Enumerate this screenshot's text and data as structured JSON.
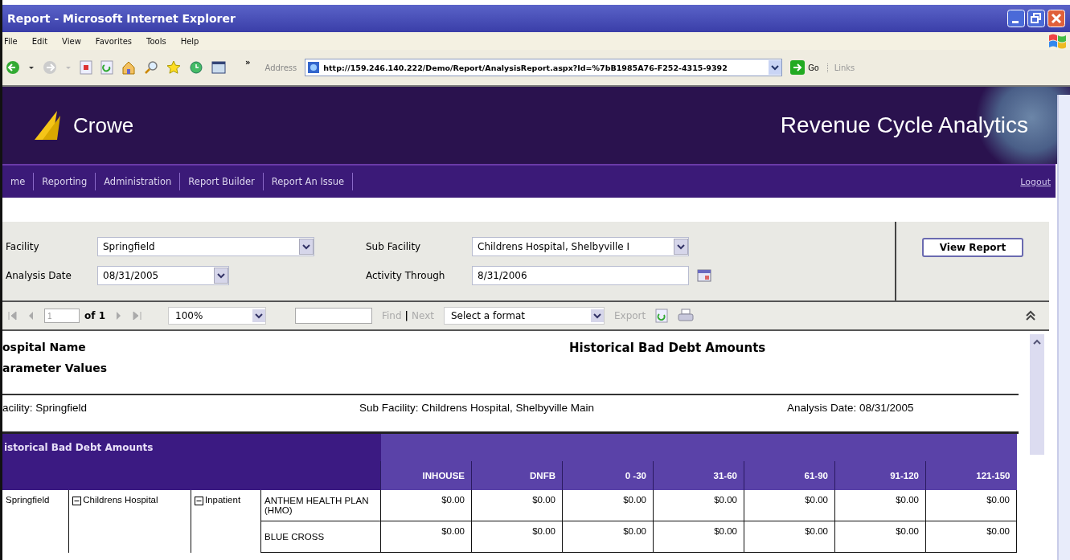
{
  "window": {
    "title": "Report - Microsoft Internet Explorer"
  },
  "menu": [
    "File",
    "Edit",
    "View",
    "Favorites",
    "Tools",
    "Help"
  ],
  "toolbar": {
    "overflow": "»",
    "address_label": "Address",
    "address": "http://159.246.140.222/Demo/Report/AnalysisReport.aspx?Id=%7bB1985A76-F252-4315-9392",
    "go": "Go",
    "links": "Links"
  },
  "banner": {
    "brand": "Crowe",
    "app_title": "Revenue Cycle Analytics"
  },
  "nav": {
    "items": [
      "me",
      "Reporting",
      "Administration",
      "Report Builder",
      "Report An Issue"
    ],
    "logout": "Logout"
  },
  "parameters": {
    "fields": [
      {
        "label": "Facility",
        "value": "Springfield",
        "kind": "select"
      },
      {
        "label": "Sub Facility",
        "value": "Childrens Hospital, Shelbyville I",
        "kind": "select"
      },
      {
        "label": "Analysis Date",
        "value": "08/31/2005",
        "kind": "short-select"
      },
      {
        "label": "Activity Through",
        "value": "8/31/2006",
        "kind": "date"
      }
    ],
    "button": "View Report"
  },
  "report_toolbar": {
    "page": "1",
    "page_count": "of 1",
    "zoom": "100%",
    "find": "Find",
    "separator": "|",
    "next": "Next",
    "format": "Select a format",
    "export": "Export",
    "disabled": true
  },
  "report": {
    "hospital_label": "ospital Name",
    "params_label": "arameter Values",
    "title": "Historical Bad Debt Amounts",
    "facility": "acility: Springfield",
    "sub_facility": "Sub Facility: Childrens Hospital, Shelbyville Main",
    "analysis_date": "Analysis Date: 08/31/2005",
    "table": {
      "title": "istorical Bad Debt Amounts",
      "columns": [
        "INHOUSE",
        "DNFB",
        "0 -30",
        "31-60",
        "61-90",
        "91-120",
        "121-150"
      ],
      "facility": "Springfield",
      "hospital": {
        "label": "Childrens Hospital",
        "expanded": true
      },
      "type": {
        "label": "Inpatient",
        "expanded": true
      },
      "rows": [
        {
          "payer": "ANTHEM HEALTH PLAN (HMO)",
          "values": [
            "$0.00",
            "$0.00",
            "$0.00",
            "$0.00",
            "$0.00",
            "$0.00",
            "$0.00"
          ]
        },
        {
          "payer": "BLUE CROSS",
          "values": [
            "$0.00",
            "$0.00",
            "$0.00",
            "$0.00",
            "$0.00",
            "$0.00",
            "$0.00"
          ]
        }
      ]
    }
  }
}
